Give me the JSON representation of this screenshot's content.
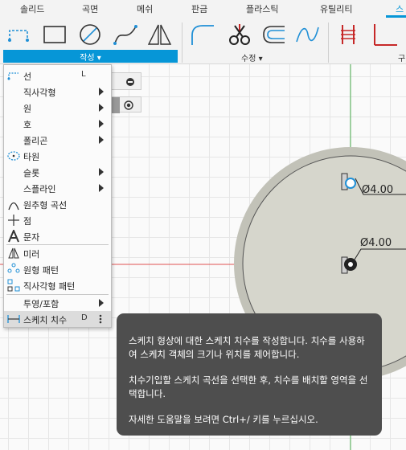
{
  "tabs": [
    "솔리드",
    "곡면",
    "메쉬",
    "판금",
    "플라스틱",
    "유틸리티",
    "스"
  ],
  "active_tab": "스",
  "toolbar": {
    "create_label": "작성 ▾",
    "modify_label": "수정 ▾",
    "constraint_label": "구"
  },
  "menu": [
    {
      "label": "선",
      "shortcut": "L"
    },
    {
      "label": "직사각형"
    },
    {
      "label": "원"
    },
    {
      "label": "호"
    },
    {
      "label": "폴리곤"
    },
    {
      "label": "타원"
    },
    {
      "label": "슬롯"
    },
    {
      "label": "스플라인"
    },
    {
      "label": "원추형 곡선"
    },
    {
      "label": "점"
    },
    {
      "label": "문자"
    },
    {
      "label": "미러"
    },
    {
      "label": "원형 패턴"
    },
    {
      "label": "직사각형 패턴"
    },
    {
      "label": "투영/포함"
    },
    {
      "label": "스케치 치수",
      "shortcut": "D"
    }
  ],
  "canvas": {
    "dim_top": "Ø4.00",
    "dim_bottom": "Ø4.00"
  },
  "tooltip": {
    "p1": "스케치 형상에 대한 스케치 치수를 작성합니다. 치수를 사용하여 스케치 객체의 크기나 위치를 제어합니다.",
    "p2": "치수기입할 스케치 곡선을 선택한 후, 치수를 배치할 영역을 선택합니다.",
    "p3": "자세한 도움말을 보려면 Ctrl+/ 키를 누르십시오."
  },
  "colors": {
    "accent": "#0696d7",
    "axis_red": "#e05252",
    "axis_green": "#4caf50",
    "tooltip_bg": "#4e4e4e"
  }
}
